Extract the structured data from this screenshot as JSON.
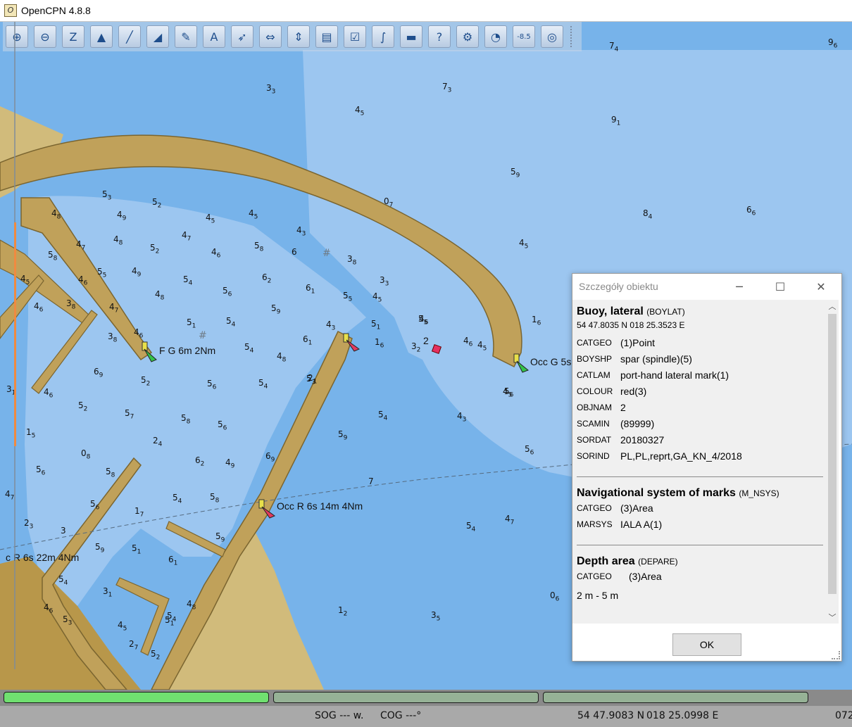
{
  "window": {
    "title": "OpenCPN 4.8.8"
  },
  "toolbar": {
    "buttons": [
      {
        "name": "zoom-in-icon",
        "glyph": "⊕"
      },
      {
        "name": "zoom-out-icon",
        "glyph": "⊖"
      },
      {
        "name": "scale-down-icon",
        "glyph": "Z"
      },
      {
        "name": "scale-up-icon",
        "glyph": "▲"
      },
      {
        "name": "route-icon",
        "glyph": "╱"
      },
      {
        "name": "auto-follow-icon",
        "glyph": "◢"
      },
      {
        "name": "settings-icon",
        "glyph": "✎"
      },
      {
        "name": "text-icon",
        "glyph": "A"
      },
      {
        "name": "current-icon",
        "glyph": "➶"
      },
      {
        "name": "tide-icon",
        "glyph": "⇔"
      },
      {
        "name": "measure-icon",
        "glyph": "⇕"
      },
      {
        "name": "print-icon",
        "glyph": "▤"
      },
      {
        "name": "route-manager-icon",
        "glyph": "☑"
      },
      {
        "name": "track-icon",
        "glyph": "∫"
      },
      {
        "name": "color-scheme-icon",
        "glyph": "▬"
      },
      {
        "name": "help-icon",
        "glyph": "?"
      },
      {
        "name": "plugin-icon",
        "glyph": "⚙"
      },
      {
        "name": "ais-icon",
        "glyph": "◔"
      },
      {
        "name": "depth-icon",
        "glyph": "-8.5"
      },
      {
        "name": "mob-icon",
        "glyph": "◎"
      }
    ]
  },
  "chart": {
    "lights": [
      {
        "text": "F G 6m 2Nm"
      },
      {
        "text": "Occ G 5s"
      },
      {
        "text": "Occ R 6s 14m 4Nm"
      },
      {
        "text": "c R 6s 22m 4Nm"
      }
    ],
    "buoy_label": "2",
    "soundings": [
      {
        "v": "7",
        "s": "4"
      },
      {
        "v": "9",
        "s": "6"
      },
      {
        "v": "3",
        "s": "3"
      },
      {
        "v": "7",
        "s": "3"
      },
      {
        "v": "4",
        "s": "5"
      },
      {
        "v": "9",
        "s": "1"
      },
      {
        "v": "5",
        "s": "9"
      },
      {
        "v": "8",
        "s": "4"
      },
      {
        "v": "6",
        "s": "6"
      },
      {
        "v": "5",
        "s": "3"
      },
      {
        "v": "5",
        "s": "2"
      },
      {
        "v": "0",
        "s": "7"
      },
      {
        "v": "4",
        "s": "8"
      },
      {
        "v": "4",
        "s": "9"
      },
      {
        "v": "4",
        "s": "5"
      },
      {
        "v": "4",
        "s": "5"
      },
      {
        "v": "4",
        "s": "7"
      },
      {
        "v": "4",
        "s": "3"
      },
      {
        "v": "4",
        "s": "8"
      },
      {
        "v": "4",
        "s": "7"
      },
      {
        "v": "5",
        "s": "2"
      },
      {
        "v": "4",
        "s": "6"
      },
      {
        "v": "5",
        "s": "8"
      },
      {
        "v": "6",
        "s": ""
      },
      {
        "v": "5",
        "s": "8"
      },
      {
        "v": "3",
        "s": "8"
      },
      {
        "v": "4",
        "s": "5"
      },
      {
        "v": "5",
        "s": "5"
      },
      {
        "v": "4",
        "s": "9"
      },
      {
        "v": "5",
        "s": "4"
      },
      {
        "v": "6",
        "s": "2"
      },
      {
        "v": "3",
        "s": "3"
      },
      {
        "v": "4",
        "s": "5"
      },
      {
        "v": "4",
        "s": "6"
      },
      {
        "v": "4",
        "s": "8"
      },
      {
        "v": "5",
        "s": "6"
      },
      {
        "v": "6",
        "s": "1"
      },
      {
        "v": "5",
        "s": "5"
      },
      {
        "v": "4",
        "s": "5"
      },
      {
        "v": "3",
        "s": "8"
      },
      {
        "v": "4",
        "s": "7"
      },
      {
        "v": "4",
        "s": "6"
      },
      {
        "v": "5",
        "s": "9"
      },
      {
        "v": "5",
        "s": "1"
      },
      {
        "v": "5",
        "s": "4"
      },
      {
        "v": "4",
        "s": "3"
      },
      {
        "v": "5",
        "s": "1"
      },
      {
        "v": "5",
        "s": "5"
      },
      {
        "v": "1",
        "s": "6"
      },
      {
        "v": "3",
        "s": "2"
      },
      {
        "v": "4",
        "s": "6"
      },
      {
        "v": "4",
        "s": "5"
      },
      {
        "v": "1",
        "s": "6"
      },
      {
        "v": "4",
        "s": "6"
      },
      {
        "v": "3",
        "s": "8"
      },
      {
        "v": "5",
        "s": "4"
      },
      {
        "v": "4",
        "s": "8"
      },
      {
        "v": "6",
        "s": "1"
      },
      {
        "v": "5",
        "s": "6"
      },
      {
        "v": "6",
        "s": "9"
      },
      {
        "v": "5",
        "s": "2"
      },
      {
        "v": "5",
        "s": "6"
      },
      {
        "v": "5",
        "s": "4"
      },
      {
        "v": "5",
        "s": "3"
      },
      {
        "v": "4",
        "s": "6"
      },
      {
        "v": "5",
        "s": "2"
      },
      {
        "v": "5",
        "s": "7"
      },
      {
        "v": "5",
        "s": "8"
      },
      {
        "v": "5",
        "s": "6"
      },
      {
        "v": "5",
        "s": "4"
      },
      {
        "v": "4",
        "s": "3"
      },
      {
        "v": "1",
        "s": "5"
      },
      {
        "v": "2",
        "s": "4"
      },
      {
        "v": "5",
        "s": "9"
      },
      {
        "v": "5",
        "s": "6"
      },
      {
        "v": "0",
        "s": "8"
      },
      {
        "v": "5",
        "s": "6"
      },
      {
        "v": "5",
        "s": "8"
      },
      {
        "v": "6",
        "s": "2"
      },
      {
        "v": "4",
        "s": "9"
      },
      {
        "v": "7",
        "s": ""
      },
      {
        "v": "5",
        "s": "6"
      },
      {
        "v": "1",
        "s": "7"
      },
      {
        "v": "5",
        "s": "4"
      },
      {
        "v": "5",
        "s": "8"
      },
      {
        "v": "5",
        "s": "4"
      },
      {
        "v": "4",
        "s": "7"
      },
      {
        "v": "2",
        "s": "3"
      },
      {
        "v": "3",
        "s": ""
      },
      {
        "v": "5",
        "s": "9"
      },
      {
        "v": "5",
        "s": "1"
      },
      {
        "v": "6",
        "s": "1"
      },
      {
        "v": "5",
        "s": "9"
      },
      {
        "v": "5",
        "s": "4"
      },
      {
        "v": "3",
        "s": "1"
      },
      {
        "v": "4",
        "s": "8"
      },
      {
        "v": "5",
        "s": "4"
      },
      {
        "v": "4",
        "s": "7"
      },
      {
        "v": "4",
        "s": "5"
      },
      {
        "v": "5",
        "s": "1"
      },
      {
        "v": "2",
        "s": "7"
      },
      {
        "v": "5",
        "s": "2"
      },
      {
        "v": "1",
        "s": "2"
      },
      {
        "v": "3",
        "s": "5"
      },
      {
        "v": "0",
        "s": "6"
      },
      {
        "v": "2",
        "s": "1"
      },
      {
        "v": "3",
        "s": "1"
      },
      {
        "v": "4",
        "s": "6"
      },
      {
        "v": "5",
        "s": "3"
      },
      {
        "v": "4",
        "s": "5"
      },
      {
        "v": "4",
        "s": "6"
      },
      {
        "v": "6",
        "s": "9"
      },
      {
        "v": "5",
        "s": "5"
      },
      {
        "v": "5",
        "s": ""
      }
    ]
  },
  "dialog": {
    "title": "Szczegóły obiektu",
    "ok_label": "OK",
    "objects": [
      {
        "name": "Buoy, lateral",
        "code": "(BOYLAT)",
        "position": "54 47.8035 N 018 25.3523 E",
        "attrs": [
          {
            "k": "CATGEO",
            "v": "(1)Point"
          },
          {
            "k": "BOYSHP",
            "v": "spar (spindle)(5)"
          },
          {
            "k": "CATLAM",
            "v": "port-hand lateral mark(1)"
          },
          {
            "k": "COLOUR",
            "v": "red(3)"
          },
          {
            "k": "OBJNAM",
            "v": "2"
          },
          {
            "k": "SCAMIN",
            "v": "(89999)"
          },
          {
            "k": "SORDAT",
            "v": "20180327"
          },
          {
            "k": "SORIND",
            "v": "PL,PL,reprt,GA_KN_4/2018"
          }
        ]
      },
      {
        "name": "Navigational system of marks",
        "code": "(M_NSYS)",
        "attrs": [
          {
            "k": "CATGEO",
            "v": "(3)Area"
          },
          {
            "k": "MARSYS",
            "v": "IALA A(1)"
          }
        ]
      },
      {
        "name": "Depth area",
        "code": "(DEPARE)",
        "attrs": [
          {
            "k": "CATGEO",
            "v": "(3)Area"
          }
        ],
        "extra": "2 m - 5 m"
      }
    ]
  },
  "status": {
    "sog": "SOG --- w.",
    "cog": "COG ---°",
    "lat": "54 47.9083 N",
    "lon": "018 25.0998 E",
    "scale": "072"
  },
  "colors": {
    "deep_water": "#77b3ea",
    "shallow_water": "#9cc6f0",
    "land": "#d1bb7b",
    "breakwater": "#c0a15a",
    "progress_active": "#70e070",
    "progress_idle": "#96b296"
  }
}
